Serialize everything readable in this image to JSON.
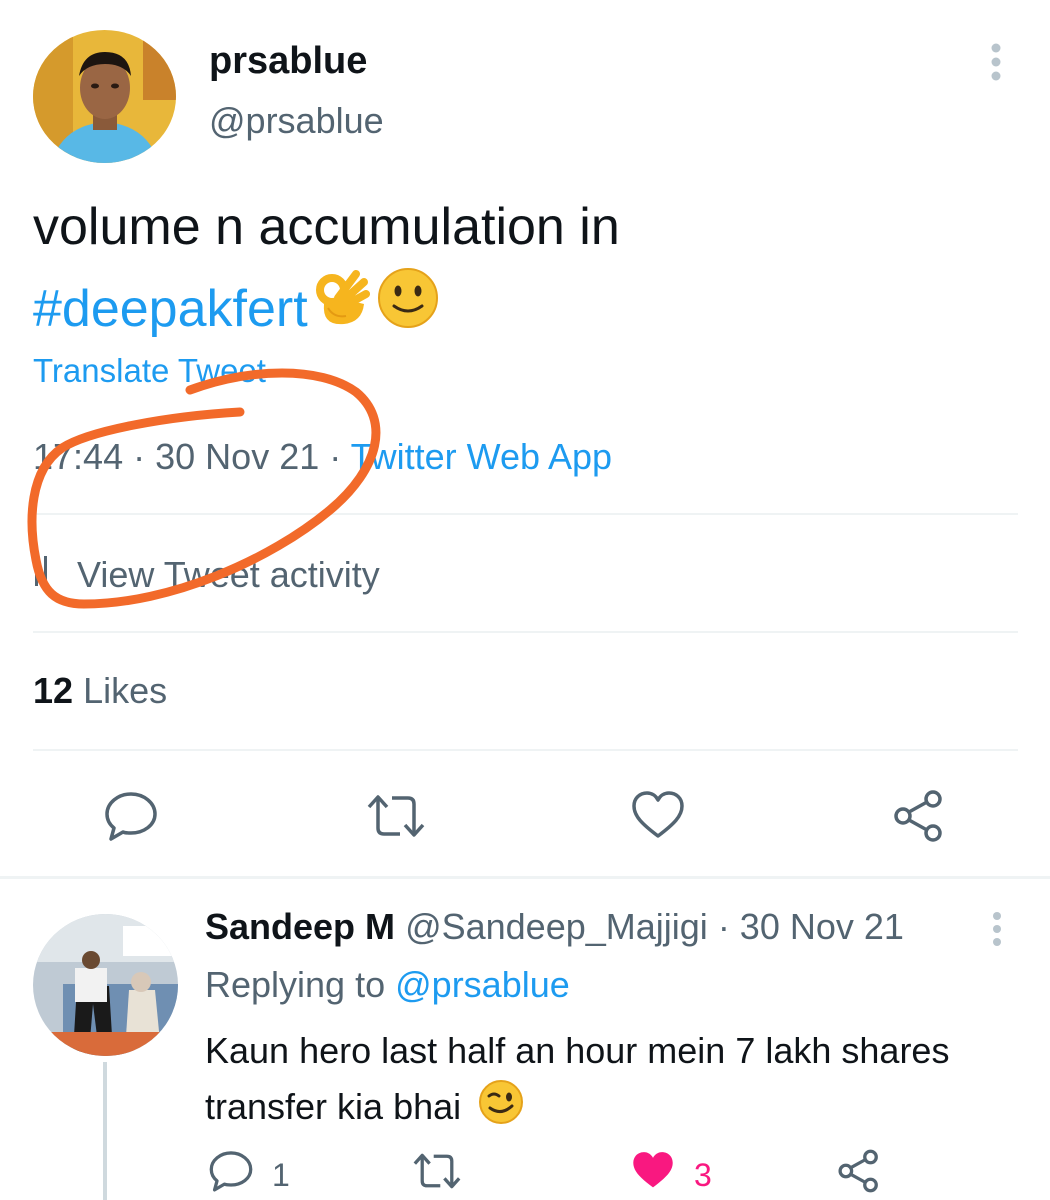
{
  "tweet": {
    "display_name": "prsablue",
    "handle": "@prsablue",
    "text_plain": "volume n accumulation in",
    "hashtag": "#deepakfert",
    "translate_label": "Translate Tweet",
    "time": "17:44",
    "date": "30 Nov 21",
    "separator": "·",
    "source": "Twitter Web App",
    "activity_label": "View Tweet activity",
    "likes_count": "12",
    "likes_label": "Likes"
  },
  "reply": {
    "display_name": "Sandeep M",
    "handle": "@Sandeep_Majjigi",
    "date": "· 30 Nov 21",
    "replying_prefix": "Replying to",
    "replying_handle": "@prsablue",
    "text": "Kaun hero last half an hour mein 7 lakh shares transfer kia bhai",
    "reply_count": "1",
    "like_count": "3"
  },
  "colors": {
    "accent": "#1d9bf0",
    "text": "#0f1419",
    "secondary": "#536471",
    "like": "#f91880",
    "annotation": "#f26a2a"
  },
  "icons": [
    "ok-hand-emoji",
    "smile-emoji",
    "more-icon",
    "chart-icon",
    "reply-icon",
    "retweet-icon",
    "heart-icon",
    "share-icon",
    "wink-emoji"
  ]
}
